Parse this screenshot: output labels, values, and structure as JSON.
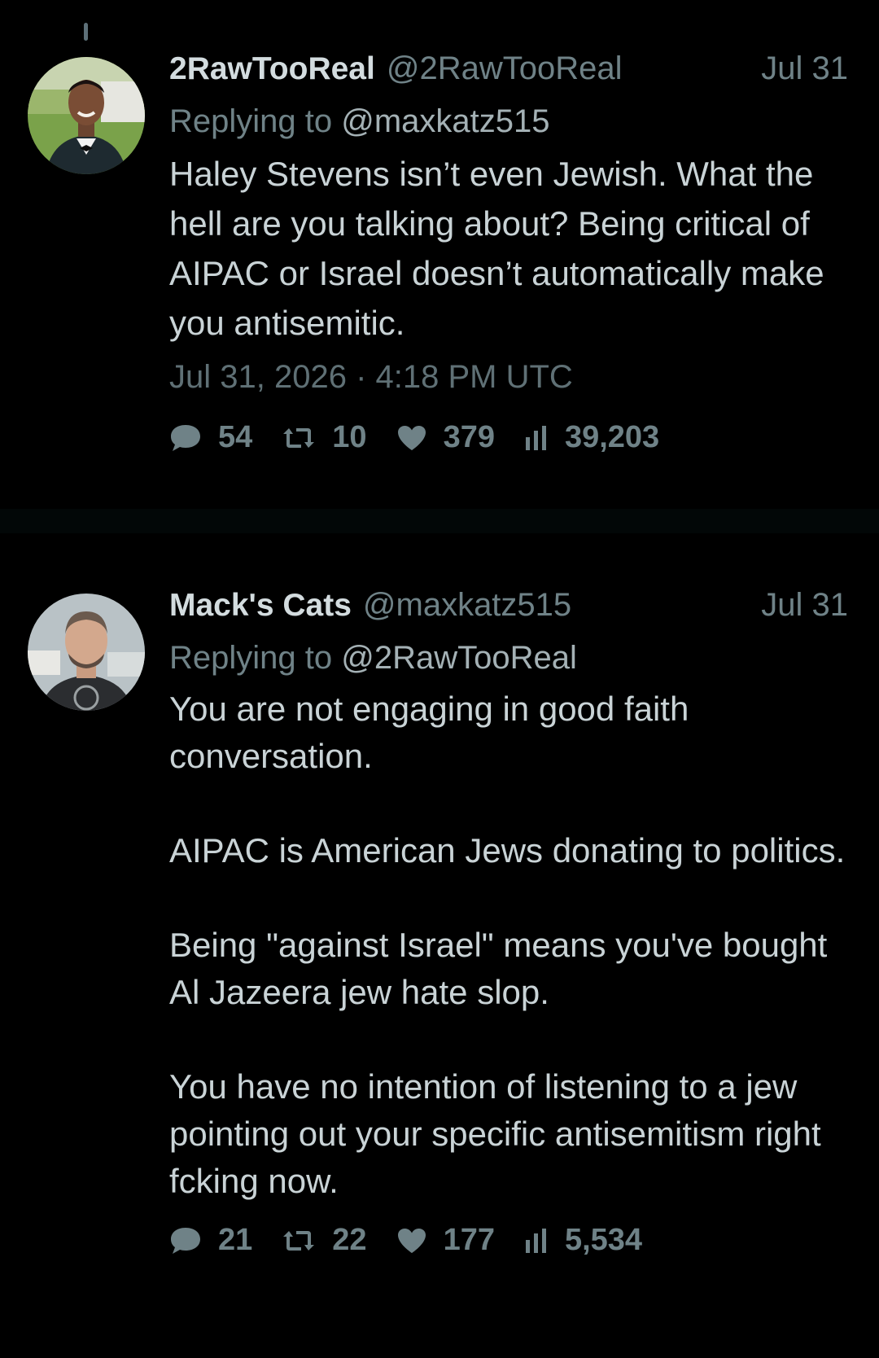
{
  "colors": {
    "background": "#000000",
    "text": "#c9d3d6",
    "muted": "#6f8287",
    "name": "#d3dcdf"
  },
  "tweets": [
    {
      "display_name": "2RawTooReal",
      "handle": "@2RawTooReal",
      "date": "Jul 31",
      "replying_prefix": "Replying to",
      "replying_to": "@maxkatz515",
      "paragraphs": [
        "Haley Stevens isn’t even Jewish. What the hell are you talking about? Being critical of AIPAC or Israel doesn’t automatically make you antisemitic."
      ],
      "timestamp": "Jul 31, 2026 · 4:18 PM UTC",
      "stats": {
        "replies": "54",
        "retweets": "10",
        "likes": "379",
        "views": "39,203"
      }
    },
    {
      "display_name": "Mack's Cats",
      "handle": "@maxkatz515",
      "date": "Jul 31",
      "replying_prefix": "Replying to",
      "replying_to": "@2RawTooReal",
      "paragraphs": [
        "You are not engaging in good faith conversation.",
        "AIPAC is American Jews donating to politics.",
        "Being \"against Israel\" means you've bought Al Jazeera jew hate slop.",
        "You have no intention of listening to a jew pointing out your specific antisemitism right fcking now."
      ],
      "stats": {
        "replies": "21",
        "retweets": "22",
        "likes": "177",
        "views": "5,534"
      }
    }
  ],
  "icons": {
    "reply": "comment-bubble-icon",
    "retweet": "retweet-icon",
    "like": "heart-icon",
    "views": "bar-chart-icon"
  }
}
